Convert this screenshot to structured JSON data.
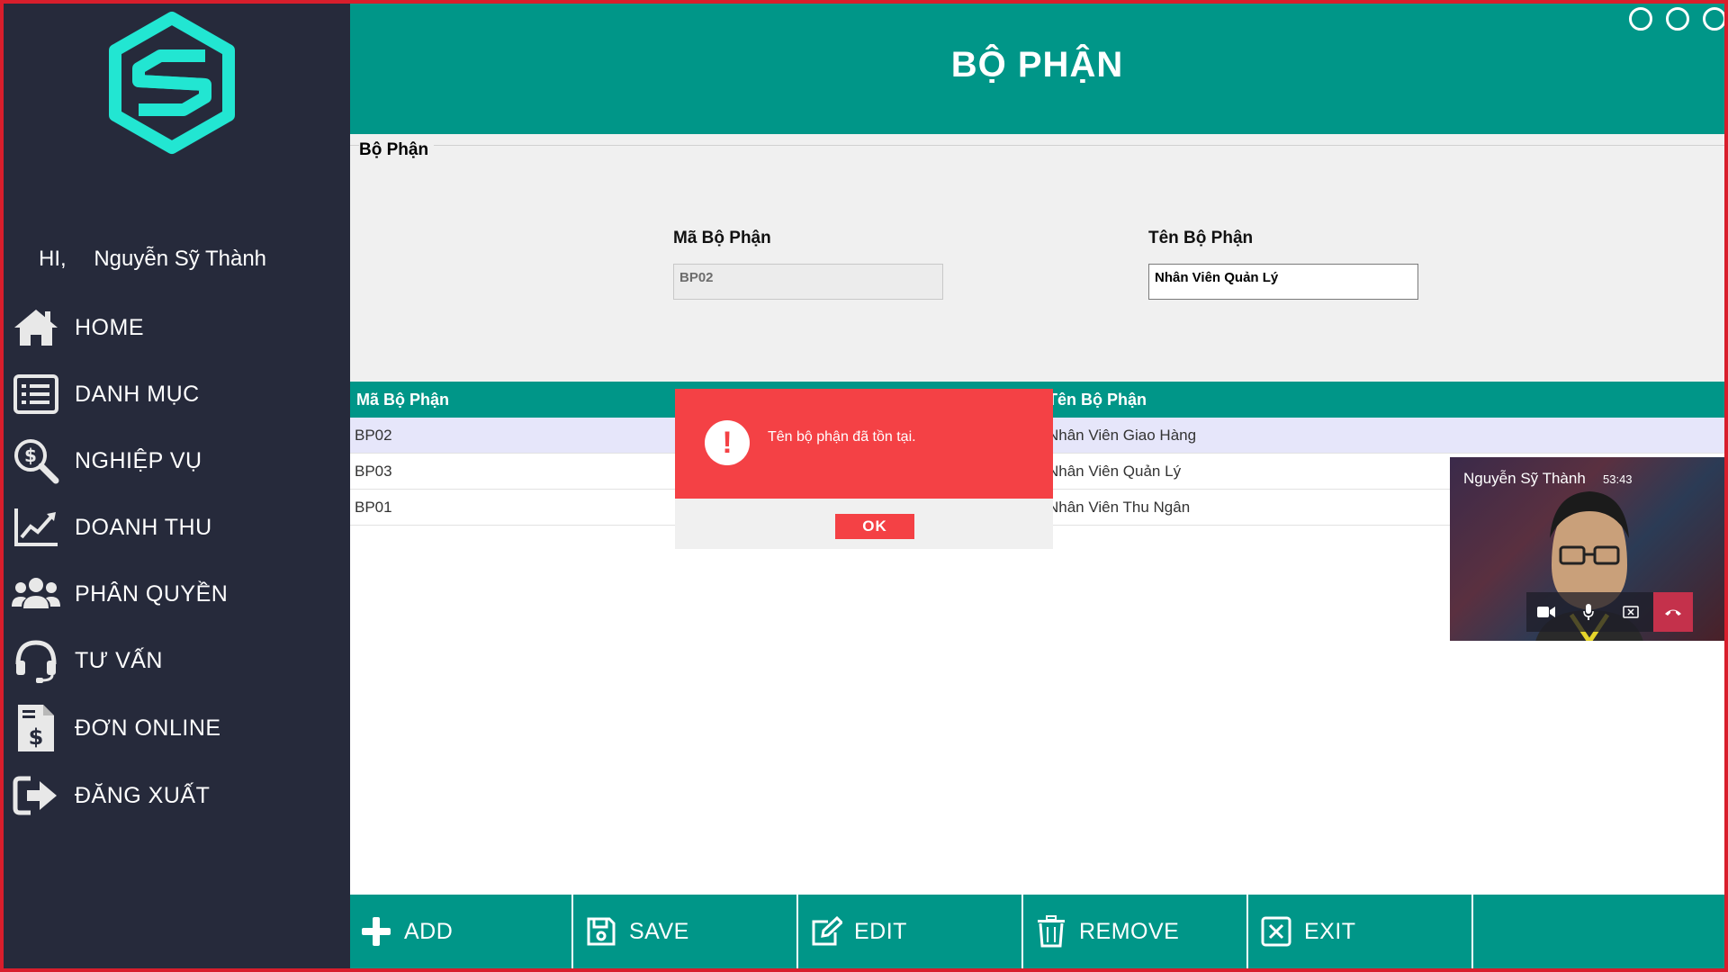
{
  "app": {
    "greeting_hi": "HI,",
    "user_name": "Nguyễn Sỹ Thành"
  },
  "sidebar": {
    "items": [
      {
        "label": "HOME",
        "icon": "home-icon"
      },
      {
        "label": "DANH MỤC",
        "icon": "list-icon"
      },
      {
        "label": "NGHIỆP VỤ",
        "icon": "search-dollar-icon"
      },
      {
        "label": "DOANH THU",
        "icon": "chart-line-icon"
      },
      {
        "label": "PHÂN QUYỀN",
        "icon": "users-icon"
      },
      {
        "label": "TƯ VẤN",
        "icon": "headset-icon"
      },
      {
        "label": "ĐƠN ONLINE",
        "icon": "invoice-icon"
      },
      {
        "label": "ĐĂNG XUẤT",
        "icon": "sign-out-icon"
      }
    ]
  },
  "header": {
    "title": "BỘ PHẬN"
  },
  "form": {
    "group_title": "Bộ Phận",
    "code_label": "Mã Bộ Phận",
    "code_value": "BP02",
    "name_label": "Tên Bộ Phận",
    "name_value": "Nhân Viên Quản Lý"
  },
  "table": {
    "headers": [
      "Mã Bộ Phận",
      "Tên Bộ Phận"
    ],
    "rows": [
      {
        "code": "BP02",
        "name": "Nhân Viên Giao Hàng"
      },
      {
        "code": "BP03",
        "name": "Nhân Viên Quản Lý"
      },
      {
        "code": "BP01",
        "name": "Nhân Viên Thu Ngân"
      }
    ]
  },
  "toolbar": {
    "add_label": "ADD",
    "save_label": "SAVE",
    "edit_label": "EDIT",
    "remove_label": "REMOVE",
    "exit_label": "EXIT"
  },
  "dialog": {
    "message": "Tên bộ phận đã tồn tại.",
    "ok_label": "OK"
  },
  "video_call": {
    "caller_name": "Nguyễn Sỹ Thành",
    "duration": "53:43"
  },
  "colors": {
    "teal": "#009688",
    "sidebar": "#262a3b",
    "alert_red": "#f44145",
    "selected_row": "#e6e6fa",
    "window_border": "#d81e2c"
  }
}
